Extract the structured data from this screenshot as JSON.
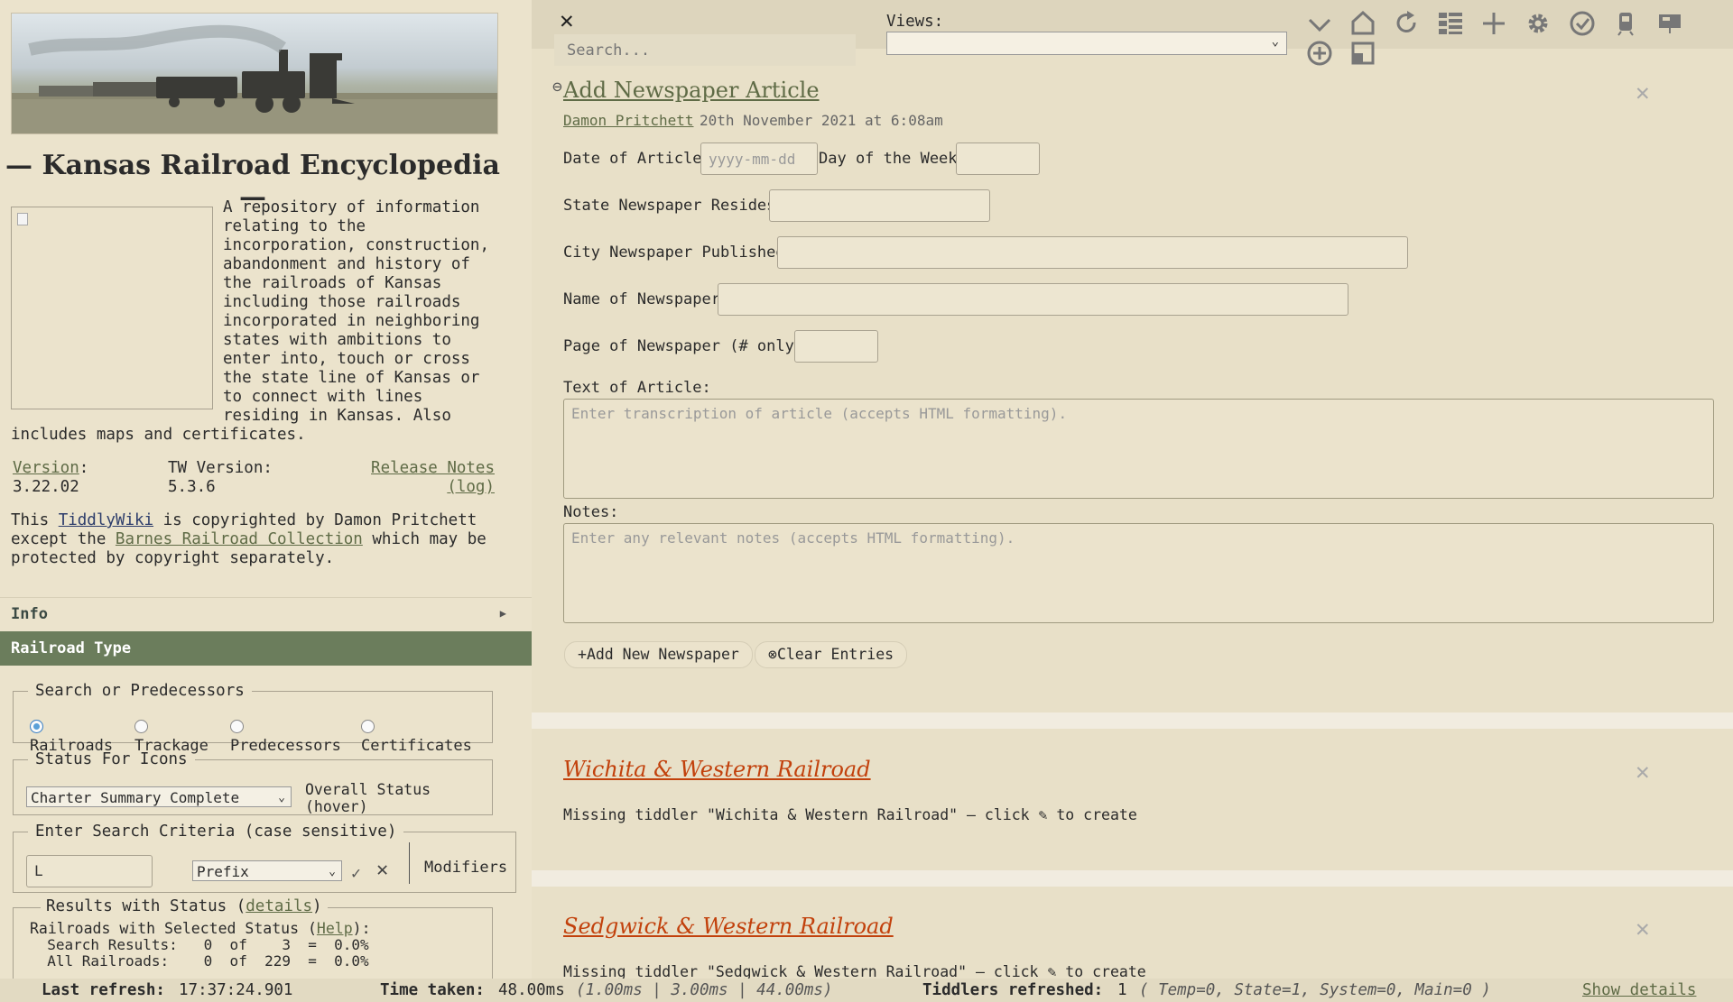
{
  "sidebar": {
    "title": "— Kansas Railroad Encyclopedia —",
    "description": "A repository of information relating to the incorporation, construction, abandonment and history of the railroads of Kansas including those railroads incorporated in neighboring states with ambitions to enter into, touch or cross the state line of Kansas or to connect with lines residing in Kansas. Also includes maps and certificates.",
    "version_label": "Version",
    "version_value": "3.22.02",
    "tw_label": "TW Version:",
    "tw_value": "5.3.6",
    "release_notes": "Release Notes",
    "log": "(log)",
    "copy_pre": "This ",
    "copy_link1": "TiddlyWiki",
    "copy_mid": " is copyrighted by Damon Pritchett except the ",
    "copy_link2": "Barnes Railroad Collection",
    "copy_post": " which may be protected by copyright separately.",
    "info_label": "Info",
    "railroad_type_label": "Railroad Type",
    "search_predecessors": {
      "legend": "Search or Predecessors",
      "options": [
        "Railroads",
        "Trackage",
        "Predecessors",
        "Certificates"
      ],
      "selected": "Railroads"
    },
    "status_icons": {
      "legend": "Status For Icons",
      "selected": "Charter Summary Complete",
      "overall": "Overall Status",
      "hover": "(hover)"
    },
    "search_criteria": {
      "legend": "Enter Search Criteria (case sensitive)",
      "value": "L",
      "mode": "Prefix",
      "modifiers": "Modifiers"
    },
    "results": {
      "legend_pre": "Results with Status (",
      "legend_link": "details",
      "legend_post": ")",
      "line1_pre": "Railroads with Selected Status (",
      "line1_link": "Help",
      "line1_post": "):",
      "line2": "  Search Results:   0  of    3  =  0.0%",
      "line3": "  All Railroads:    0  of  229  =  0.0%"
    }
  },
  "topbar": {
    "search_placeholder": "Search...",
    "views_label": "Views:",
    "icons": [
      "chevron-down-icon",
      "home-icon",
      "refresh-icon",
      "layout-icon",
      "plus-icon",
      "gear-icon",
      "check-circle-icon",
      "train-icon",
      "projector-icon",
      "add-circle-icon",
      "window-icon"
    ]
  },
  "form": {
    "title": "Add Newspaper Article",
    "author": "Damon Pritchett",
    "date": "20th November 2021 at 6:08am",
    "date_label": "Date of Article:",
    "date_placeholder": "yyyy-mm-dd",
    "dow_label": "Day of the Week:",
    "state_label": "State Newspaper Resides:",
    "city_label": "City Newspaper Published:",
    "name_label": "Name of Newspaper:",
    "page_label": "Page of Newspaper (# only):",
    "text_label": "Text of Article:",
    "text_placeholder": "Enter transcription of article (accepts HTML formatting).",
    "notes_label": "Notes:",
    "notes_placeholder": "Enter any relevant notes (accepts HTML formatting).",
    "add_button": "Add New Newspaper",
    "clear_button": "Clear Entries"
  },
  "tiddlers": [
    {
      "title": "Wichita & Western Railroad",
      "missing": "Missing tiddler \"Wichita & Western Railroad\" – click ",
      "create": " to create"
    },
    {
      "title": "Sedgwick & Western Railroad",
      "missing": "Missing tiddler \"Sedgwick & Western Railroad\" – click ",
      "create": " to create"
    }
  ],
  "status": {
    "last_refresh_label": "Last refresh:",
    "last_refresh": "17:37:24.901",
    "time_taken_label": "Time taken:",
    "time_taken": "48.00ms",
    "time_breakdown": "(1.00ms | 3.00ms | 44.00ms)",
    "tiddlers_label": "Tiddlers refreshed:",
    "tiddlers_count": "1",
    "tiddlers_breakdown": "( Temp=0, State=1, System=0, Main=0 )",
    "show_details": "Show details"
  }
}
